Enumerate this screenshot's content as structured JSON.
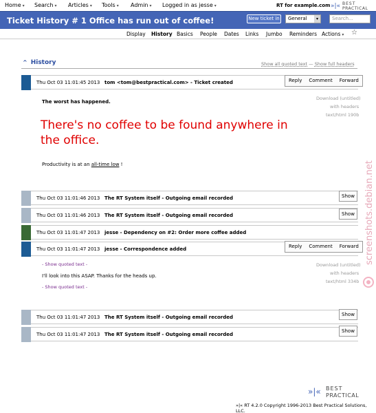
{
  "topnav": {
    "items": [
      {
        "label": "Home"
      },
      {
        "label": "Search"
      },
      {
        "label": "Articles"
      },
      {
        "label": "Tools"
      },
      {
        "label": "Admin"
      },
      {
        "label": "Logged in as jesse"
      }
    ],
    "rt_for": "RT for example.com"
  },
  "logo": {
    "best": "BEST",
    "practical": "PRACTICAL"
  },
  "header": {
    "title": "Ticket History # 1 Office has run out of coffee!",
    "new_ticket_label": "New ticket in",
    "queue_value": "General",
    "search_placeholder": "Search..."
  },
  "tabs": [
    {
      "label": "Display"
    },
    {
      "label": "History"
    },
    {
      "label": "Basics"
    },
    {
      "label": "People"
    },
    {
      "label": "Dates"
    },
    {
      "label": "Links"
    },
    {
      "label": "Jumbo"
    },
    {
      "label": "Reminders"
    },
    {
      "label": "Actions"
    }
  ],
  "history": {
    "heading": "History",
    "show_quoted": "Show all quoted text",
    "sep": "—",
    "show_headers": "Show full headers"
  },
  "transactions": [
    {
      "date": "Thu Oct 03 11:01:45 2013",
      "desc": "tom <tom@bestpractical.com> - Ticket created",
      "color": "#1c5b94"
    },
    {
      "date": "Thu Oct 03 11:01:46 2013",
      "desc": "The RT System itself - Outgoing email recorded",
      "color": "#a9b7c6"
    },
    {
      "date": "Thu Oct 03 11:01:46 2013",
      "desc": "The RT System itself - Outgoing email recorded",
      "color": "#a9b7c6"
    },
    {
      "date": "Thu Oct 03 11:01:47 2013",
      "desc": "jesse - Dependency on #2: Order more coffee added",
      "color": "#3a6a35"
    },
    {
      "date": "Thu Oct 03 11:01:47 2013",
      "desc": "jesse - Correspondence added",
      "color": "#1c5b94"
    },
    {
      "date": "Thu Oct 03 11:01:47 2013",
      "desc": "The RT System itself - Outgoing email recorded",
      "color": "#a9b7c6"
    },
    {
      "date": "Thu Oct 03 11:01:47 2013",
      "desc": "The RT System itself - Outgoing email recorded",
      "color": "#a9b7c6"
    }
  ],
  "buttons": {
    "reply": "Reply",
    "comment": "Comment",
    "forward": "Forward",
    "show": "Show"
  },
  "first_message": {
    "line1": "The worst has happened.",
    "big": "There's no coffee to be found anywhere in the office.",
    "prod_prefix": "Productivity is at an ",
    "prod_link": "all-time low",
    "prod_suffix": " !",
    "meta1": "Download (untitled)",
    "meta2": "with headers",
    "meta3": "text/html 190b"
  },
  "second_message": {
    "quoted1": "- Show quoted text -",
    "reply": "I'll look into this ASAP. Thanks for the heads up.",
    "quoted2": "- Show quoted text -",
    "meta1": "Download (untitled)",
    "meta2": "with headers",
    "meta3": "text/html 334b"
  },
  "watermark": "screenshots.debian.net",
  "footer": "»|« RT 4.2.0 Copyright 1996-2013 Best Practical Solutions, LLC."
}
